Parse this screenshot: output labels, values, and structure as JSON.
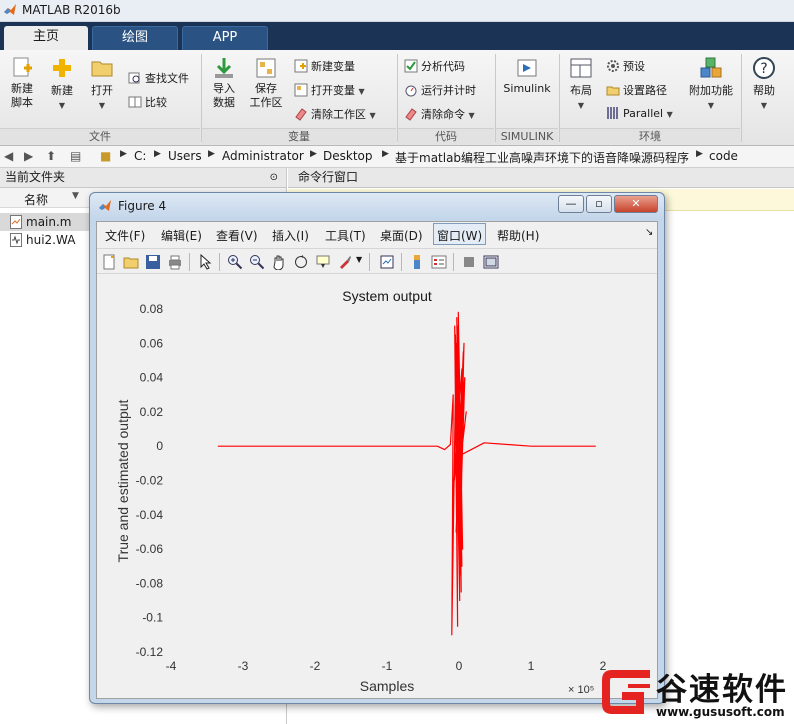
{
  "app": {
    "title": "MATLAB R2016b"
  },
  "tabs": [
    "主页",
    "绘图",
    "APP"
  ],
  "ribbon": {
    "new_script": "新建\n脚本",
    "new": "新建",
    "open": "打开",
    "find_files": "查找文件",
    "compare": "比较",
    "import_data": "导入\n数据",
    "save_workspace": "保存\n工作区",
    "new_variable": "新建变量",
    "open_variable": "打开变量",
    "clear_workspace": "清除工作区",
    "analyze_code": "分析代码",
    "run_and_time": "运行并计时",
    "clear_commands": "清除命令",
    "simulink": "Simulink",
    "layout": "布局",
    "preferences": "预设",
    "set_path": "设置路径",
    "parallel": "Parallel",
    "add_ons": "附加功能",
    "help": "帮助",
    "groups": {
      "file": "文件",
      "variable": "变量",
      "code": "代码",
      "simulink": "SIMULINK",
      "environment": "环境"
    }
  },
  "address": {
    "segments": [
      "C:",
      "Users",
      "Administrator",
      "Desktop",
      "基于matlab编程工业高噪声环境下的语音降噪源码程序",
      "code"
    ]
  },
  "current_folder": {
    "title": "当前文件夹",
    "column_name": "名称",
    "files": [
      "main.m",
      "hui2.WA"
    ]
  },
  "command_window": {
    "title": "命令行窗口"
  },
  "figure": {
    "title": "Figure 4",
    "menu": [
      "文件(F)",
      "编辑(E)",
      "查看(V)",
      "插入(I)",
      "工具(T)",
      "桌面(D)",
      "窗口(W)",
      "帮助(H)"
    ],
    "buttons": {
      "minimize": "—",
      "maximize": "▫",
      "close": "✕"
    }
  },
  "chart_data": {
    "type": "line",
    "title": "System output",
    "xlabel": "Samples",
    "ylabel": "True and estimated output",
    "xlim": [
      -4,
      2
    ],
    "ylim": [
      -0.12,
      0.08
    ],
    "x_exponent": "× 10⁵",
    "xticks": [
      -4,
      -3,
      -2,
      -1,
      0,
      1,
      2
    ],
    "xtick_labels": [
      "-4",
      "-3",
      "-2",
      "-1",
      "0",
      "1",
      "2"
    ],
    "yticks": [
      0.08,
      0.06,
      0.04,
      0.02,
      0,
      -0.02,
      -0.04,
      -0.06,
      -0.08,
      -0.1,
      -0.12
    ],
    "ytick_labels": [
      "0.08",
      "0.06",
      "0.04",
      "0.02",
      "0",
      "-0.02",
      "-0.04",
      "-0.06",
      "-0.08",
      "-0.1",
      "-0.12"
    ],
    "grid": false,
    "series": [
      {
        "color": "#ff0000",
        "x": [
          -3.35,
          -0.3,
          -0.2,
          -0.12,
          -0.08,
          -0.1,
          -0.04,
          -0.02,
          -0.06,
          0.01,
          -0.03,
          0.04,
          -0.05,
          0.03,
          -0.01,
          0.05,
          -0.02,
          0.02,
          0.06,
          -0.04,
          0.07,
          0.0,
          0.04,
          -0.09,
          0.08,
          0.02,
          0.06,
          -0.01,
          0.1,
          0.03,
          0.35,
          1.0,
          1.9
        ],
        "y": [
          0.0,
          0.0,
          -0.002,
          0.001,
          0.03,
          -0.11,
          0.06,
          -0.105,
          0.07,
          -0.09,
          0.075,
          -0.07,
          0.065,
          -0.085,
          0.078,
          -0.06,
          0.07,
          -0.075,
          0.055,
          -0.05,
          0.06,
          -0.065,
          0.045,
          -0.03,
          0.04,
          -0.04,
          0.035,
          -0.02,
          0.02,
          -0.005,
          0.002,
          0.0,
          0.0
        ]
      }
    ]
  },
  "watermark": {
    "brand": "谷速软件",
    "url": "www.gususoft.com"
  },
  "colors": {
    "ribbon_tab_bg": "#1b3456",
    "plot_line": "#ff0000",
    "axes_bg": "#f0f0f0"
  }
}
